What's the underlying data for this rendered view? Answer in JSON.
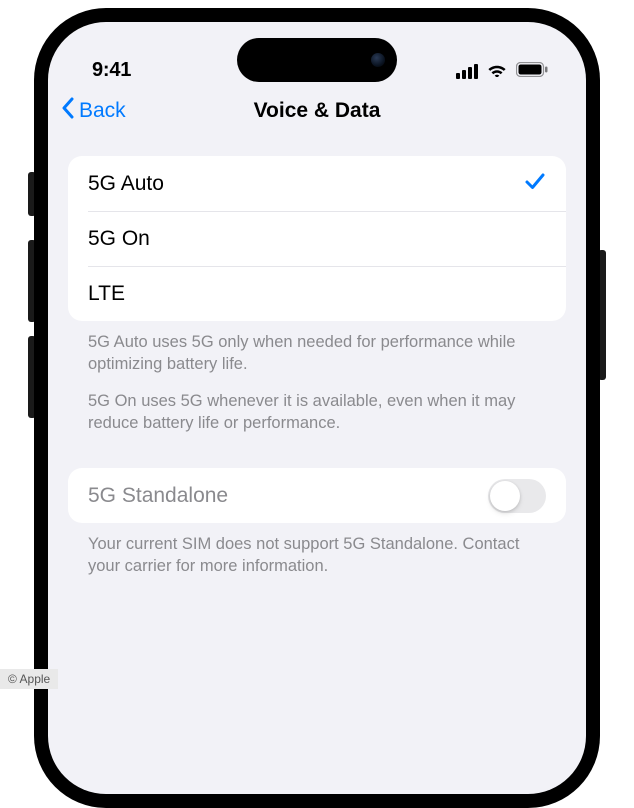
{
  "status": {
    "time": "9:41"
  },
  "nav": {
    "back_label": "Back",
    "title": "Voice & Data"
  },
  "options": [
    {
      "label": "5G Auto",
      "selected": true
    },
    {
      "label": "5G On",
      "selected": false
    },
    {
      "label": "LTE",
      "selected": false
    }
  ],
  "footer": {
    "line1": "5G Auto uses 5G only when needed for performance while optimizing battery life.",
    "line2": "5G On uses 5G whenever it is available, even when it may reduce battery life or performance."
  },
  "standalone": {
    "label": "5G Standalone",
    "on": false,
    "note": "Your current SIM does not support 5G Standalone. Contact your carrier for more information."
  },
  "attribution": "© Apple"
}
